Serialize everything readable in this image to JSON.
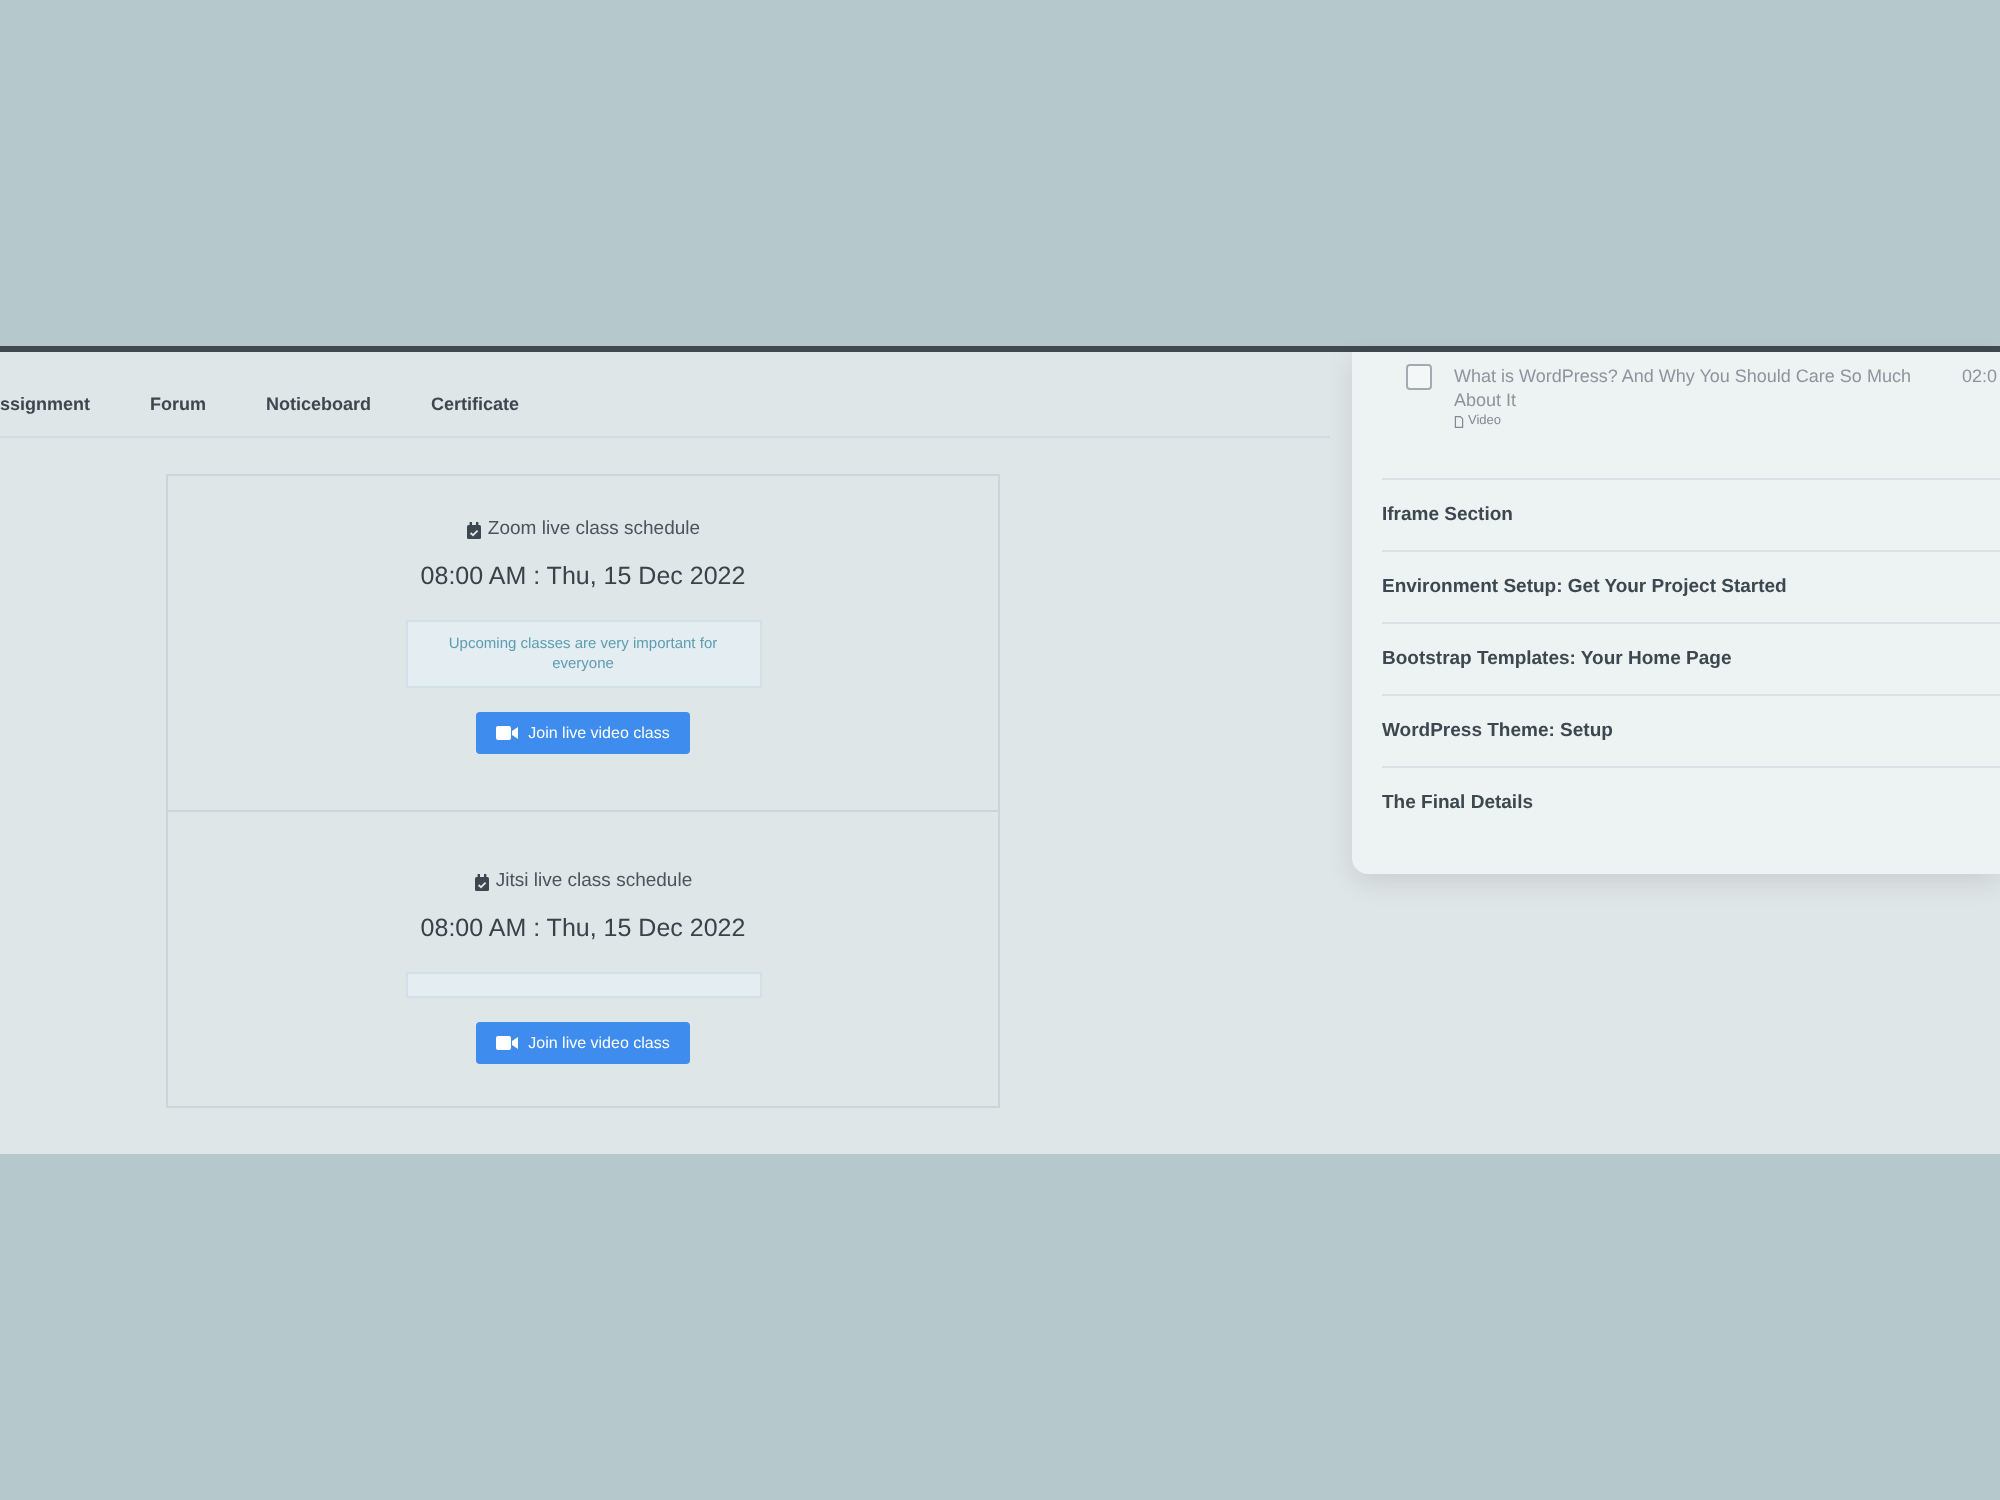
{
  "tabs": [
    "ssignment",
    "Forum",
    "Noticeboard",
    "Certificate"
  ],
  "schedules": [
    {
      "title": "Zoom live class schedule",
      "datetime": "08:00 AM : Thu, 15 Dec 2022",
      "notice": "Upcoming classes are very important for everyone",
      "button": "Join live video class"
    },
    {
      "title": "Jitsi live class schedule",
      "datetime": "08:00 AM : Thu, 15 Dec 2022",
      "button": "Join live video class"
    }
  ],
  "curriculum": {
    "lesson": {
      "title": "What is WordPress? And Why You Should Care So Much About It",
      "type": "Video",
      "duration": "02:0",
      "checked": false
    },
    "sections": [
      "Iframe Section",
      "Environment Setup: Get Your Project Started",
      "Bootstrap Templates: Your Home Page",
      "WordPress Theme: Setup",
      "The Final Details"
    ]
  }
}
